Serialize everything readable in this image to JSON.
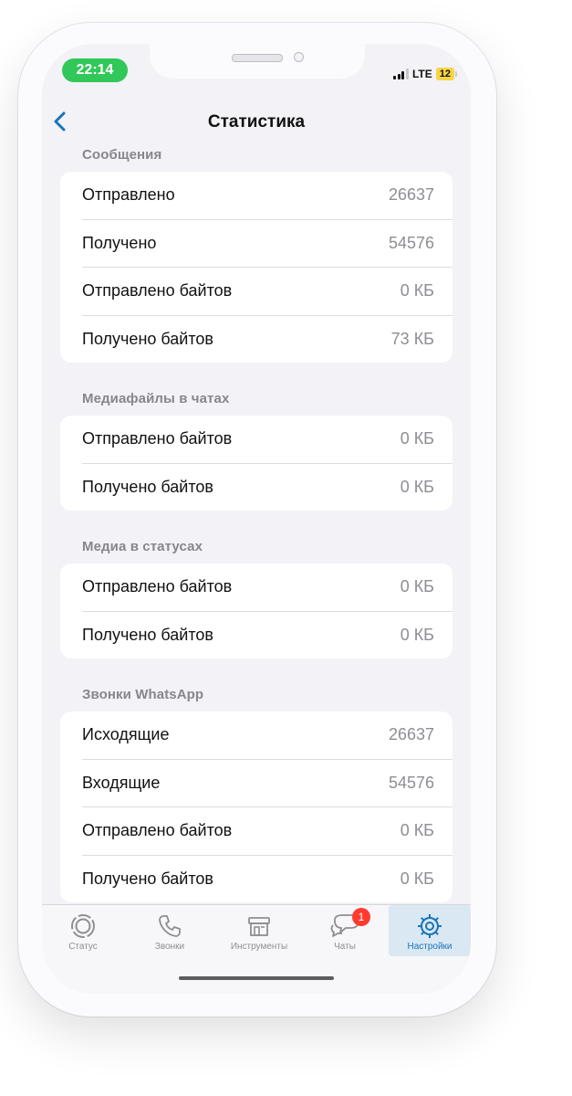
{
  "status_bar": {
    "time": "22:14",
    "network": "LTE",
    "battery": "12"
  },
  "nav": {
    "back_icon": "chevron-left-icon",
    "title": "Статистика"
  },
  "sections": [
    {
      "title": "Сообщения",
      "rows": [
        {
          "label": "Отправлено",
          "value": "26637"
        },
        {
          "label": "Получено",
          "value": "54576"
        },
        {
          "label": "Отправлено байтов",
          "value": "0 КБ"
        },
        {
          "label": "Получено байтов",
          "value": "73 КБ"
        }
      ]
    },
    {
      "title": "Медиафайлы в чатах",
      "rows": [
        {
          "label": "Отправлено байтов",
          "value": "0 КБ"
        },
        {
          "label": "Получено байтов",
          "value": "0 КБ"
        }
      ]
    },
    {
      "title": "Медиа в статусах",
      "rows": [
        {
          "label": "Отправлено байтов",
          "value": "0 КБ"
        },
        {
          "label": "Получено байтов",
          "value": "0 КБ"
        }
      ]
    },
    {
      "title": "Звонки WhatsApp",
      "rows": [
        {
          "label": "Исходящие",
          "value": "26637"
        },
        {
          "label": "Входящие",
          "value": "54576"
        },
        {
          "label": "Отправлено байтов",
          "value": "0 КБ"
        },
        {
          "label": "Получено байтов",
          "value": "0 КБ"
        }
      ]
    }
  ],
  "tabbar": {
    "tabs": [
      {
        "label": "Статус",
        "icon": "status-icon"
      },
      {
        "label": "Звонки",
        "icon": "phone-icon"
      },
      {
        "label": "Инструменты",
        "icon": "store-icon"
      },
      {
        "label": "Чаты",
        "icon": "chat-bubbles-icon",
        "badge": "1"
      },
      {
        "label": "Настройки",
        "icon": "settings-gear-icon",
        "active": true
      }
    ]
  },
  "colors": {
    "accent": "#1a74b8",
    "time_pill": "#32c759",
    "badge": "#ff3b30",
    "battery": "#f7d547"
  }
}
